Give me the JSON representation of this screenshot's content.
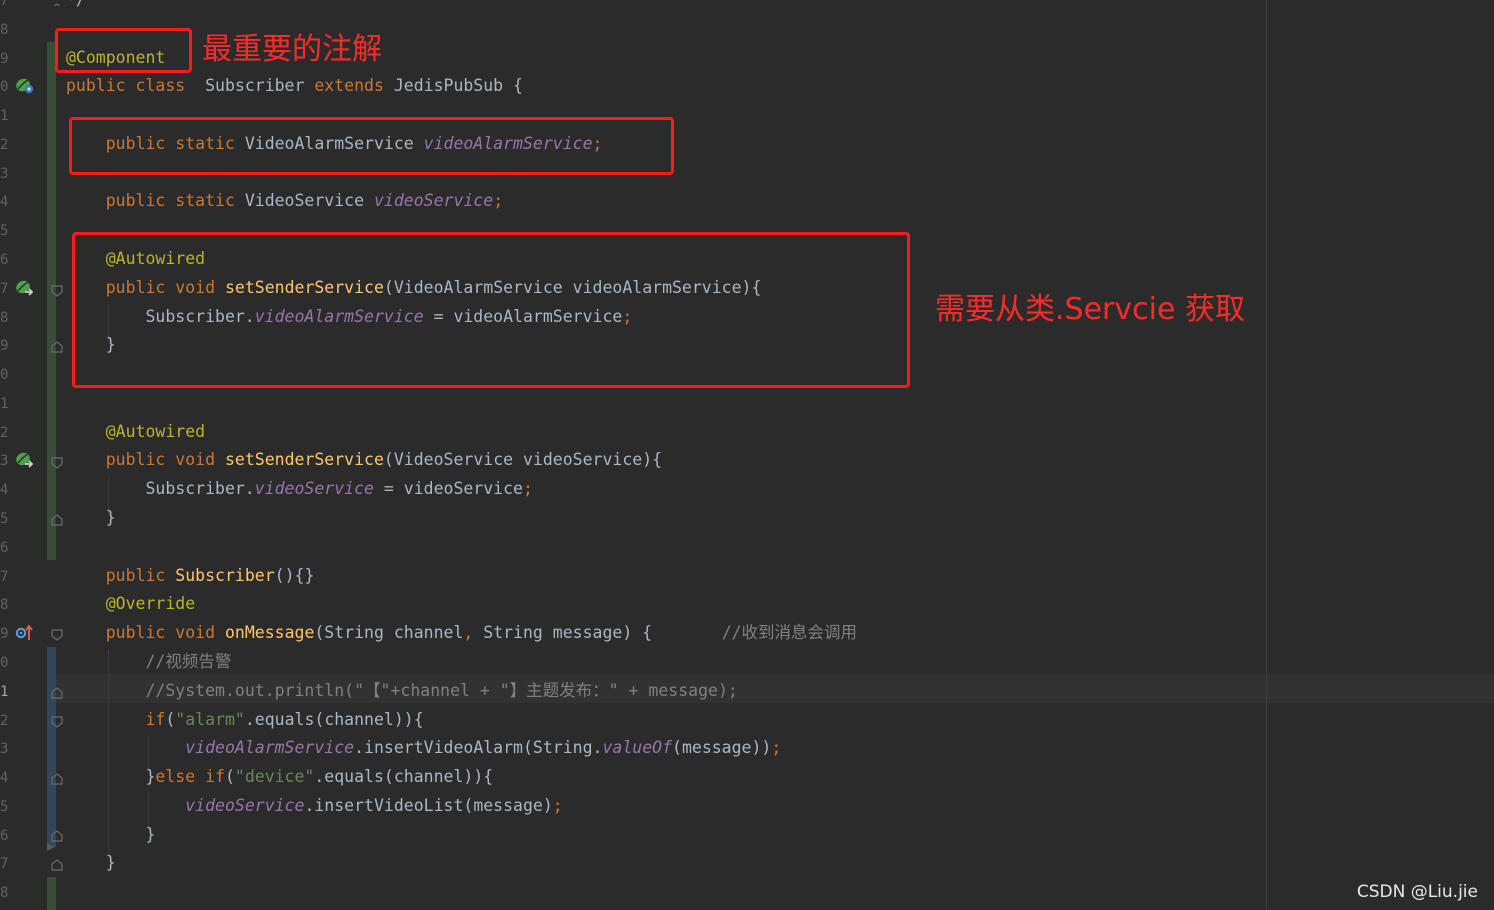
{
  "editor": {
    "gutter_line_numbers": [
      "7",
      "8",
      "9",
      "0",
      "1",
      "2",
      "3",
      "4",
      "5",
      "6",
      "7",
      "8",
      "9",
      "0",
      "1",
      "2",
      "3",
      "4",
      "5",
      "6",
      "7",
      "8",
      "9",
      "0",
      "1",
      "2",
      "3",
      "4",
      "5",
      "6",
      "7",
      "8"
    ],
    "current_line_index": 24,
    "lines": [
      [
        {
          "t": "plain",
          "v": "*/"
        }
      ],
      [],
      [
        {
          "t": "ann",
          "v": "@Component"
        }
      ],
      [
        {
          "t": "kw",
          "v": "public class"
        },
        {
          "t": "plain",
          "v": "  Subscriber "
        },
        {
          "t": "kw",
          "v": "extends"
        },
        {
          "t": "plain",
          "v": " JedisPubSub {"
        }
      ],
      [],
      [
        {
          "t": "plain",
          "v": "    "
        },
        {
          "t": "kw",
          "v": "public static"
        },
        {
          "t": "plain",
          "v": " VideoAlarmService "
        },
        {
          "t": "fld",
          "v": "videoAlarmService"
        },
        {
          "t": "kw",
          "v": ";"
        }
      ],
      [],
      [
        {
          "t": "plain",
          "v": "    "
        },
        {
          "t": "kw",
          "v": "public static"
        },
        {
          "t": "plain",
          "v": " VideoService "
        },
        {
          "t": "fld",
          "v": "videoService"
        },
        {
          "t": "kw",
          "v": ";"
        }
      ],
      [],
      [
        {
          "t": "plain",
          "v": "    "
        },
        {
          "t": "ann",
          "v": "@Autowired"
        }
      ],
      [
        {
          "t": "plain",
          "v": "    "
        },
        {
          "t": "kw",
          "v": "public void"
        },
        {
          "t": "plain",
          "v": " "
        },
        {
          "t": "mth",
          "v": "setSenderService"
        },
        {
          "t": "plain",
          "v": "(VideoAlarmService videoAlarmService){"
        }
      ],
      [
        {
          "t": "plain",
          "v": "        Subscriber."
        },
        {
          "t": "fld",
          "v": "videoAlarmService"
        },
        {
          "t": "plain",
          "v": " = videoAlarmService"
        },
        {
          "t": "kw",
          "v": ";"
        }
      ],
      [
        {
          "t": "plain",
          "v": "    }"
        }
      ],
      [],
      [],
      [
        {
          "t": "plain",
          "v": "    "
        },
        {
          "t": "ann",
          "v": "@Autowired"
        }
      ],
      [
        {
          "t": "plain",
          "v": "    "
        },
        {
          "t": "kw",
          "v": "public void"
        },
        {
          "t": "plain",
          "v": " "
        },
        {
          "t": "mth",
          "v": "setSenderService"
        },
        {
          "t": "plain",
          "v": "(VideoService videoService){"
        }
      ],
      [
        {
          "t": "plain",
          "v": "        Subscriber."
        },
        {
          "t": "fld",
          "v": "videoService"
        },
        {
          "t": "plain",
          "v": " = videoService"
        },
        {
          "t": "kw",
          "v": ";"
        }
      ],
      [
        {
          "t": "plain",
          "v": "    }"
        }
      ],
      [],
      [
        {
          "t": "plain",
          "v": "    "
        },
        {
          "t": "kw",
          "v": "public"
        },
        {
          "t": "plain",
          "v": " "
        },
        {
          "t": "mth",
          "v": "Subscriber"
        },
        {
          "t": "plain",
          "v": "(){}"
        }
      ],
      [
        {
          "t": "plain",
          "v": "    "
        },
        {
          "t": "ann",
          "v": "@Override"
        }
      ],
      [
        {
          "t": "plain",
          "v": "    "
        },
        {
          "t": "kw",
          "v": "public void"
        },
        {
          "t": "plain",
          "v": " "
        },
        {
          "t": "mth",
          "v": "onMessage"
        },
        {
          "t": "plain",
          "v": "(String channel"
        },
        {
          "t": "kw",
          "v": ","
        },
        {
          "t": "plain",
          "v": " String message) {       "
        },
        {
          "t": "cmt",
          "v": "//收到消息会调用"
        }
      ],
      [
        {
          "t": "plain",
          "v": "        "
        },
        {
          "t": "cmt",
          "v": "//视频告警"
        }
      ],
      [
        {
          "t": "plain",
          "v": "        "
        },
        {
          "t": "cmt",
          "v": "//System.out.println(\"【\"+channel + \"】主题发布：\" + message);"
        }
      ],
      [
        {
          "t": "plain",
          "v": "        "
        },
        {
          "t": "kw",
          "v": "if"
        },
        {
          "t": "plain",
          "v": "("
        },
        {
          "t": "str",
          "v": "\"alarm\""
        },
        {
          "t": "plain",
          "v": ".equals(channel)){"
        }
      ],
      [
        {
          "t": "plain",
          "v": "            "
        },
        {
          "t": "fld",
          "v": "videoAlarmService"
        },
        {
          "t": "plain",
          "v": ".insertVideoAlarm(String."
        },
        {
          "t": "fld",
          "v": "valueOf"
        },
        {
          "t": "plain",
          "v": "(message))"
        },
        {
          "t": "kw",
          "v": ";"
        }
      ],
      [
        {
          "t": "plain",
          "v": "        }"
        },
        {
          "t": "kw",
          "v": "else if"
        },
        {
          "t": "plain",
          "v": "("
        },
        {
          "t": "str",
          "v": "\"device\""
        },
        {
          "t": "plain",
          "v": ".equals(channel)){"
        }
      ],
      [
        {
          "t": "plain",
          "v": "            "
        },
        {
          "t": "fld",
          "v": "videoService"
        },
        {
          "t": "plain",
          "v": ".insertVideoList(message)"
        },
        {
          "t": "kw",
          "v": ";"
        }
      ],
      [
        {
          "t": "plain",
          "v": "        }"
        }
      ],
      [
        {
          "t": "plain",
          "v": "    }"
        }
      ],
      []
    ]
  },
  "annotations": {
    "most_important_annotation": "最重要的注解",
    "get_from_service_class": "需要从类.Servcie 获取"
  },
  "watermark": "CSDN @Liu.jie",
  "colors": {
    "background": "#2b2b2b",
    "keyword": "#cc7832",
    "annotation": "#bbb529",
    "field": "#9876aa",
    "method": "#ffc66d",
    "string": "#6a8759",
    "comment": "#808080",
    "text": "#a9b7c6",
    "highlight_red": "#ff1a1a"
  },
  "gutter_icons": [
    "spring-bean-icon",
    "spring-autowired-icon",
    "spring-autowired-icon",
    "override-method-icon"
  ]
}
